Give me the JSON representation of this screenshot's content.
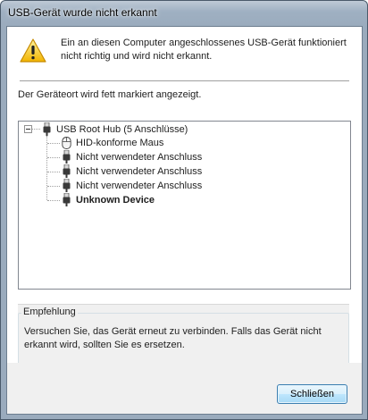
{
  "window": {
    "title": "USB-Gerät wurde nicht erkannt"
  },
  "message": {
    "icon": "warning-icon",
    "text": "Ein an diesen Computer angeschlossenes USB-Gerät funktioniert nicht richtig und wird nicht erkannt."
  },
  "hint": "Der Geräteort wird fett markiert angezeigt.",
  "tree": {
    "root": {
      "label": "USB Root Hub (5 Anschlüsse)",
      "icon": "usb-plug-icon",
      "expanded": true
    },
    "children": [
      {
        "label": "HID-konforme Maus",
        "icon": "mouse-icon",
        "bold": false
      },
      {
        "label": "Nicht verwendeter Anschluss",
        "icon": "usb-plug-icon",
        "bold": false
      },
      {
        "label": "Nicht verwendeter Anschluss",
        "icon": "usb-plug-icon",
        "bold": false
      },
      {
        "label": "Nicht verwendeter Anschluss",
        "icon": "usb-plug-icon",
        "bold": false
      },
      {
        "label": "Unknown Device",
        "icon": "usb-plug-icon",
        "bold": true
      }
    ]
  },
  "recommendation": {
    "title": "Empfehlung",
    "text": "Versuchen Sie, das Gerät erneut zu verbinden. Falls das Gerät nicht erkannt wird, sollten Sie es ersetzen."
  },
  "buttons": {
    "close": "Schließen"
  }
}
